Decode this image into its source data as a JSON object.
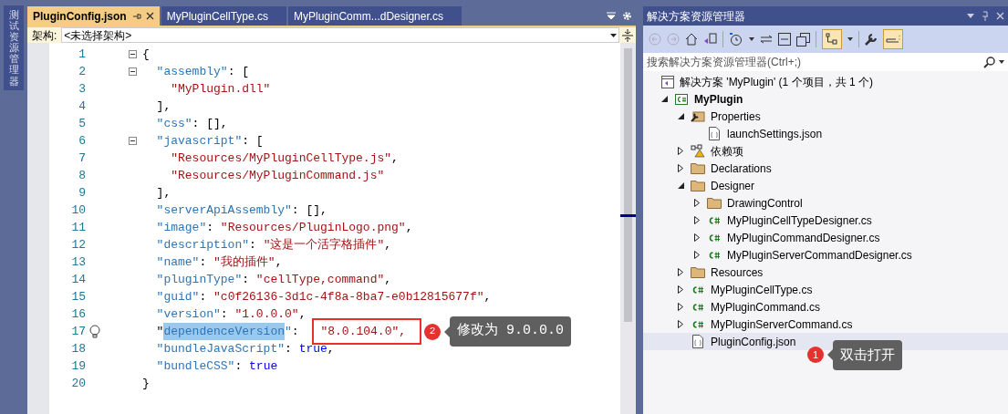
{
  "side_strip": {
    "label": "测试资源管理器"
  },
  "tabs": [
    {
      "label": "PluginConfig.json",
      "selected": true
    },
    {
      "label": "MyPluginCellType.cs",
      "selected": false
    },
    {
      "label": "MyPluginComm...dDesigner.cs",
      "selected": false
    }
  ],
  "nav_bar": {
    "label": "架构:",
    "value": "<未选择架构>"
  },
  "code_lines": [
    {
      "number": "1",
      "fold": true,
      "segments": [
        {
          "kind": "punct",
          "text": "{"
        }
      ]
    },
    {
      "number": "2",
      "fold": true,
      "segments": [
        {
          "kind": "key",
          "text": "  \"assembly\""
        },
        {
          "kind": "punct",
          "text": ": ["
        }
      ]
    },
    {
      "number": "3",
      "fold": false,
      "segments": [
        {
          "kind": "string",
          "text": "    \"MyPlugin.dll\""
        }
      ]
    },
    {
      "number": "4",
      "fold": false,
      "segments": [
        {
          "kind": "punct",
          "text": "  ],"
        }
      ]
    },
    {
      "number": "5",
      "fold": false,
      "segments": [
        {
          "kind": "key",
          "text": "  \"css\""
        },
        {
          "kind": "punct",
          "text": ": [],"
        }
      ]
    },
    {
      "number": "6",
      "fold": true,
      "segments": [
        {
          "kind": "key",
          "text": "  \"javascript\""
        },
        {
          "kind": "punct",
          "text": ": ["
        }
      ]
    },
    {
      "number": "7",
      "fold": false,
      "segments": [
        {
          "kind": "string",
          "text": "    \"Resources/MyPluginCellType.js\""
        },
        {
          "kind": "punct",
          "text": ","
        }
      ]
    },
    {
      "number": "8",
      "fold": false,
      "segments": [
        {
          "kind": "string",
          "text": "    \"Resources/MyPluginCommand.js\""
        }
      ]
    },
    {
      "number": "9",
      "fold": false,
      "segments": [
        {
          "kind": "punct",
          "text": "  ],"
        }
      ]
    },
    {
      "number": "10",
      "fold": false,
      "segments": [
        {
          "kind": "key",
          "text": "  \"serverApiAssembly\""
        },
        {
          "kind": "punct",
          "text": ": [],"
        }
      ]
    },
    {
      "number": "11",
      "fold": false,
      "segments": [
        {
          "kind": "key",
          "text": "  \"image\""
        },
        {
          "kind": "punct",
          "text": ": "
        },
        {
          "kind": "string",
          "text": "\"Resources/PluginLogo.png\""
        },
        {
          "kind": "punct",
          "text": ","
        }
      ]
    },
    {
      "number": "12",
      "fold": false,
      "segments": [
        {
          "kind": "key",
          "text": "  \"description\""
        },
        {
          "kind": "punct",
          "text": ": "
        },
        {
          "kind": "string",
          "text": "\"这是一个活字格插件\""
        },
        {
          "kind": "punct",
          "text": ","
        }
      ]
    },
    {
      "number": "13",
      "fold": false,
      "segments": [
        {
          "kind": "key",
          "text": "  \"name\""
        },
        {
          "kind": "punct",
          "text": ": "
        },
        {
          "kind": "string",
          "text": "\"我的插件\""
        },
        {
          "kind": "punct",
          "text": ","
        }
      ]
    },
    {
      "number": "14",
      "fold": false,
      "segments": [
        {
          "kind": "key",
          "text": "  \"pluginType\""
        },
        {
          "kind": "punct",
          "text": ": "
        },
        {
          "kind": "string",
          "text": "\"cellType,command\""
        },
        {
          "kind": "punct",
          "text": ","
        }
      ]
    },
    {
      "number": "15",
      "fold": false,
      "segments": [
        {
          "kind": "key",
          "text": "  \"guid\""
        },
        {
          "kind": "punct",
          "text": ": "
        },
        {
          "kind": "string",
          "text": "\"c0f26136-3d1c-4f8a-8ba7-e0b12815677f\""
        },
        {
          "kind": "punct",
          "text": ","
        }
      ]
    },
    {
      "number": "16",
      "fold": false,
      "segments": [
        {
          "kind": "key",
          "text": "  \"version\""
        },
        {
          "kind": "punct",
          "text": ": "
        },
        {
          "kind": "string",
          "text": "\"1.0.0.0\""
        },
        {
          "kind": "punct",
          "text": ","
        }
      ]
    },
    {
      "number": "17",
      "fold": false,
      "lightbulb": true,
      "segments": [
        {
          "kind": "punct",
          "text": "  \""
        },
        {
          "kind": "selected-key",
          "text": "dependenceVersion"
        },
        {
          "kind": "key",
          "text": "\""
        },
        {
          "kind": "punct",
          "text": ": "
        },
        {
          "kind": "boxed-string",
          "text": "\"8.0.104.0\","
        }
      ]
    },
    {
      "number": "18",
      "fold": false,
      "segments": [
        {
          "kind": "key",
          "text": "  \"bundleJavaScript\""
        },
        {
          "kind": "punct",
          "text": ": "
        },
        {
          "kind": "keyword",
          "text": "true"
        },
        {
          "kind": "punct",
          "text": ","
        }
      ]
    },
    {
      "number": "19",
      "fold": false,
      "segments": [
        {
          "kind": "key",
          "text": "  \"bundleCSS\""
        },
        {
          "kind": "punct",
          "text": ": "
        },
        {
          "kind": "keyword",
          "text": "true"
        }
      ]
    },
    {
      "number": "20",
      "fold": false,
      "segments": [
        {
          "kind": "punct",
          "text": "}"
        }
      ]
    }
  ],
  "editor_callout": {
    "badge": "2",
    "text": "修改为 9.0.0.0"
  },
  "explorer": {
    "title": "解决方案资源管理器",
    "search": {
      "placeholder": "搜索解决方案资源管理器(Ctrl+;)"
    },
    "solution": "解决方案 'MyPlugin' (1 个项目，共 1 个)",
    "tree": [
      {
        "label": "MyPlugin",
        "kind": "project",
        "expanded": true,
        "children": [
          {
            "label": "Properties",
            "kind": "properties",
            "expanded": true,
            "children": [
              {
                "label": "launchSettings.json",
                "kind": "json"
              }
            ]
          },
          {
            "label": "依赖项",
            "kind": "deps",
            "expanded": false
          },
          {
            "label": "Declarations",
            "kind": "folder",
            "expanded": false
          },
          {
            "label": "Designer",
            "kind": "folder",
            "expanded": true,
            "children": [
              {
                "label": "DrawingControl",
                "kind": "folder",
                "expanded": false
              },
              {
                "label": "MyPluginCellTypeDesigner.cs",
                "kind": "cs",
                "expanded": false
              },
              {
                "label": "MyPluginCommandDesigner.cs",
                "kind": "cs",
                "expanded": false
              },
              {
                "label": "MyPluginServerCommandDesigner.cs",
                "kind": "cs",
                "expanded": false
              }
            ]
          },
          {
            "label": "Resources",
            "kind": "folder",
            "expanded": false
          },
          {
            "label": "MyPluginCellType.cs",
            "kind": "cs",
            "expanded": false
          },
          {
            "label": "MyPluginCommand.cs",
            "kind": "cs",
            "expanded": false
          },
          {
            "label": "MyPluginServerCommand.cs",
            "kind": "cs",
            "expanded": false
          },
          {
            "label": "PluginConfig.json",
            "kind": "json",
            "selected": true,
            "callout": {
              "badge": "1",
              "text": "双击打开"
            }
          }
        ]
      }
    ]
  }
}
